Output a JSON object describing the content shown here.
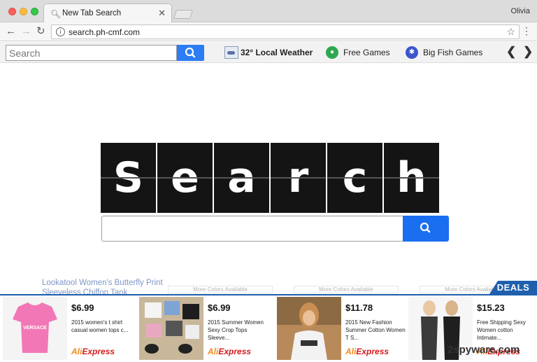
{
  "window": {
    "tab_title": "New Tab Search",
    "profile_name": "Olivia"
  },
  "toolbar": {
    "url": "search.ph-cmf.com"
  },
  "extension_bar": {
    "search_placeholder": "Search",
    "weather_label": "32° Local Weather",
    "free_games_label": "Free Games",
    "big_fish_label": "Big Fish Games"
  },
  "logo": {
    "letters": [
      "S",
      "e",
      "a",
      "r",
      "c",
      "h"
    ]
  },
  "page_remnants": {
    "faint_text": "Lookatool Women's Butterfly Print Sleeveless Chiffon Tank",
    "more_colors": "More Colors Available"
  },
  "deals": {
    "tag": "DEALS",
    "store_prefix": "Ali",
    "store_suffix": "xpress",
    "items": [
      {
        "price": "$6.99",
        "desc": "2015 women's t shirt casual women tops c..."
      },
      {
        "price": "$6.99",
        "desc": "2015 Summer Women Sexy Crop Tops Sleeve..."
      },
      {
        "price": "$11.78",
        "desc": "2015 New Fashion Summer Cotton Women T S..."
      },
      {
        "price": "$15.23",
        "desc": "Free Shipping Sexy Women cotton Intimate..."
      }
    ]
  },
  "watermark": "2spyware.com",
  "colors": {
    "accent_blue": "#1a6ef0",
    "deals_blue": "#1f5fae",
    "aliexpress_red": "#d41c1c"
  }
}
